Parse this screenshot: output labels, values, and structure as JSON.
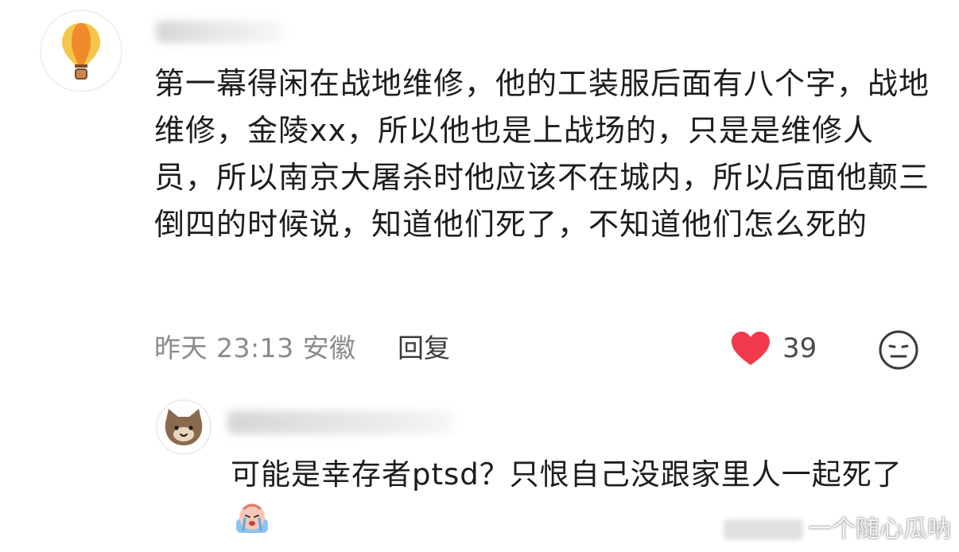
{
  "comment": {
    "avatar_icon": "hot-air-balloon-icon",
    "text": "第一幕得闲在战地维修，他的工装服后面有八个字，战地维修，金陵xx，所以他也是上战场的，只是是维修人员，所以南京大屠杀时他应该不在城内，所以后面他颠三倒四的时候说，知道他们死了，不知道他们怎么死的",
    "time": "昨天 23:13",
    "location": "安徽",
    "reply_label": "回复",
    "like_count": "39",
    "like_color": "#f0394b",
    "like_icon": "heart-icon",
    "dislike_icon": "neutral-face-icon"
  },
  "reply": {
    "avatar_icon": "cat-avatar-icon",
    "text": "可能是幸存者ptsd？只恨自己没跟家里人一起死了",
    "emoji": "crying-emoji-icon"
  },
  "watermark": {
    "text": "一个随心瓜呐"
  }
}
